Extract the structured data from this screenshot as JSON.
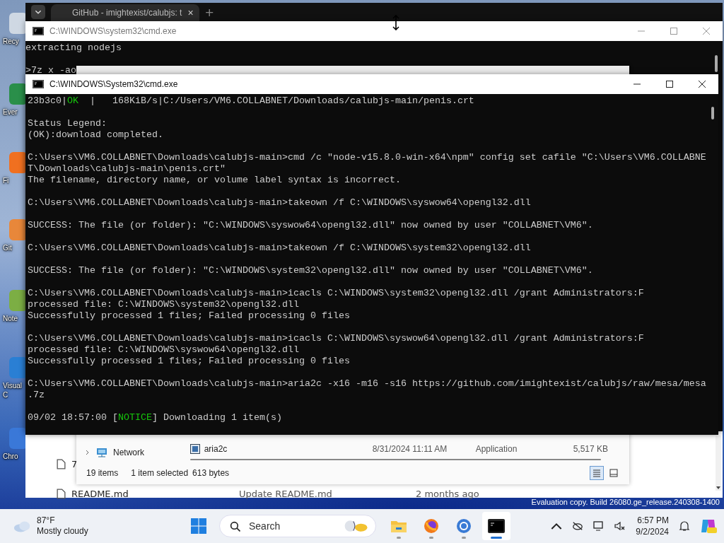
{
  "desktop_icons": [
    {
      "lines": [
        "Recy"
      ]
    },
    {
      "lines": [
        "Ever"
      ]
    },
    {
      "lines": [
        "Fi"
      ]
    },
    {
      "lines": [
        "Git"
      ]
    },
    {
      "lines": [
        "Note"
      ]
    },
    {
      "lines": [
        "Visual",
        "C"
      ]
    },
    {
      "lines": [
        "Chro"
      ]
    }
  ],
  "browser": {
    "tab_title": "GitHub - imightexist/calubjs: t",
    "tab_close": "×",
    "new_tab": "+",
    "files": [
      {
        "name": "7"
      },
      {
        "name": "README.md",
        "message": "Update README.md",
        "age": "2 months ago"
      }
    ]
  },
  "cmd_back": {
    "title": "C:\\WINDOWS\\system32\\cmd.exe",
    "lines": [
      {
        "kind": "text",
        "text": "extracting nodejs"
      },
      {
        "kind": "blank"
      },
      {
        "kind": "text",
        "text": ">7z x -ao"
      }
    ]
  },
  "explorer": {
    "nav": [
      {
        "label": "Network",
        "expanded": false
      }
    ],
    "files": [
      {
        "name": "aria2c",
        "date": "8/31/2024 11:11 AM",
        "type": "Application",
        "size": "5,517 KB"
      }
    ],
    "status": {
      "count": "19 items",
      "selection": "1 item selected",
      "size": "613 bytes"
    },
    "views": [
      {
        "kind": "details",
        "selected": true
      },
      {
        "kind": "tiles",
        "selected": false
      }
    ]
  },
  "cmd_front": {
    "title": "C:\\WINDOWS\\System32\\cmd.exe",
    "lines": [
      {
        "kind": "colored",
        "parts": [
          {
            "text": "23b3c0|",
            "highlight": false
          },
          {
            "text": "OK",
            "highlight": true
          },
          {
            "text": "  |   168KiB/s|C:/Users/VM6.COLLABNET/Downloads/calubjs-main/penis.crt",
            "highlight": false
          }
        ]
      },
      {
        "kind": "blank"
      },
      {
        "kind": "text",
        "text": "Status Legend:"
      },
      {
        "kind": "text",
        "text": "(OK):download completed."
      },
      {
        "kind": "blank"
      },
      {
        "kind": "text",
        "text": "C:\\Users\\VM6.COLLABNET\\Downloads\\calubjs-main>cmd /c \"node-v15.8.0-win-x64\\npm\" config set cafile \"C:\\Users\\VM6.COLLABNE"
      },
      {
        "kind": "text",
        "text": "T\\Downloads\\calubjs-main\\penis.crt\""
      },
      {
        "kind": "text",
        "text": "The filename, directory name, or volume label syntax is incorrect."
      },
      {
        "kind": "blank"
      },
      {
        "kind": "text",
        "text": "C:\\Users\\VM6.COLLABNET\\Downloads\\calubjs-main>takeown /f C:\\WINDOWS\\syswow64\\opengl32.dll"
      },
      {
        "kind": "blank"
      },
      {
        "kind": "text",
        "text": "SUCCESS: The file (or folder): \"C:\\WINDOWS\\syswow64\\opengl32.dll\" now owned by user \"COLLABNET\\VM6\"."
      },
      {
        "kind": "blank"
      },
      {
        "kind": "text",
        "text": "C:\\Users\\VM6.COLLABNET\\Downloads\\calubjs-main>takeown /f C:\\WINDOWS\\system32\\opengl32.dll"
      },
      {
        "kind": "blank"
      },
      {
        "kind": "text",
        "text": "SUCCESS: The file (or folder): \"C:\\WINDOWS\\system32\\opengl32.dll\" now owned by user \"COLLABNET\\VM6\"."
      },
      {
        "kind": "blank"
      },
      {
        "kind": "text",
        "text": "C:\\Users\\VM6.COLLABNET\\Downloads\\calubjs-main>icacls C:\\WINDOWS\\system32\\opengl32.dll /grant Administrators:F"
      },
      {
        "kind": "text",
        "text": "processed file: C:\\WINDOWS\\system32\\opengl32.dll"
      },
      {
        "kind": "text",
        "text": "Successfully processed 1 files; Failed processing 0 files"
      },
      {
        "kind": "blank"
      },
      {
        "kind": "text",
        "text": "C:\\Users\\VM6.COLLABNET\\Downloads\\calubjs-main>icacls C:\\WINDOWS\\syswow64\\opengl32.dll /grant Administrators:F"
      },
      {
        "kind": "text",
        "text": "processed file: C:\\WINDOWS\\syswow64\\opengl32.dll"
      },
      {
        "kind": "text",
        "text": "Successfully processed 1 files; Failed processing 0 files"
      },
      {
        "kind": "blank"
      },
      {
        "kind": "text",
        "text": "C:\\Users\\VM6.COLLABNET\\Downloads\\calubjs-main>aria2c -x16 -m16 -s16 https://github.com/imightexist/calubjs/raw/mesa/mesa"
      },
      {
        "kind": "text",
        "text": ".7z"
      },
      {
        "kind": "blank"
      },
      {
        "kind": "colored",
        "parts": [
          {
            "text": "09/02 18:57:00 [",
            "highlight": false
          },
          {
            "text": "NOTICE",
            "highlight": true
          },
          {
            "text": "] Downloading 1 item(s)",
            "highlight": false
          }
        ]
      }
    ]
  },
  "watermark_text": "Evaluation copy. Build 26080.ge_release.240308-1400",
  "taskbar": {
    "weather": {
      "temp": "87°F",
      "condition": "Mostly cloudy"
    },
    "search": {
      "placeholder": "Search"
    },
    "apps": [
      {
        "kind": "explorer",
        "active": false
      },
      {
        "kind": "firefox",
        "active": false
      },
      {
        "kind": "chrome",
        "active": false
      },
      {
        "kind": "terminal",
        "active": true
      }
    ],
    "time": "6:57 PM",
    "date": "9/2/2024"
  }
}
